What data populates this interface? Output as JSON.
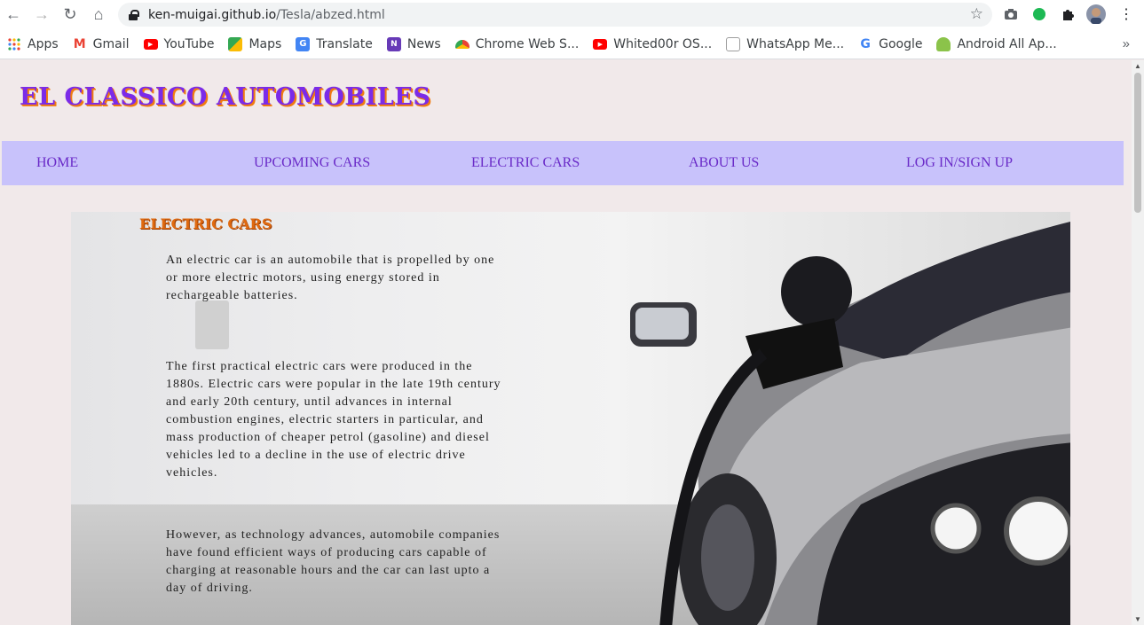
{
  "browser": {
    "url_host": "ken-muigai.github.io",
    "url_path": "/Tesla/abzed.html",
    "bookmarks": [
      {
        "label": "Apps",
        "color": "#1a73e8",
        "glyph": "⋮⋮"
      },
      {
        "label": "Gmail",
        "color": "#ea4335",
        "glyph": "M"
      },
      {
        "label": "YouTube",
        "color": "#ff0000",
        "glyph": "▶"
      },
      {
        "label": "Maps",
        "color": "#34a853",
        "glyph": "◆"
      },
      {
        "label": "Translate",
        "color": "#4285f4",
        "glyph": "G"
      },
      {
        "label": "News",
        "color": "#673ab7",
        "glyph": "N"
      },
      {
        "label": "Chrome Web S...",
        "color": "#fbbc05",
        "glyph": "◐"
      },
      {
        "label": "Whited00r OS...",
        "color": "#ff0000",
        "glyph": "▶"
      },
      {
        "label": "WhatsApp Me...",
        "color": "#9e9e9e",
        "glyph": "□"
      },
      {
        "label": "Google",
        "color": "#4285f4",
        "glyph": "G"
      },
      {
        "label": "Android All Ap...",
        "color": "#8bc34a",
        "glyph": "☺"
      }
    ],
    "more": "»"
  },
  "site": {
    "logo": "EL CLASSICO AUTOMOBILES",
    "nav": [
      "HOME",
      "UPCOMING CARS",
      "ELECTRIC CARS",
      "ABOUT US",
      "LOG IN/SIGN UP"
    ]
  },
  "content": {
    "title": "ELECTRIC CARS",
    "paragraphs": [
      "An electric car is an automobile that is propelled by one or more electric motors, using energy stored in rechargeable batteries.",
      "The first practical electric cars were produced in the 1880s. Electric cars were popular in the late 19th century and early 20th century, until advances in internal combustion engines, electric starters in particular, and mass production of cheaper petrol (gasoline) and diesel vehicles led to a decline in the use of electric drive vehicles.",
      "However, as technology advances, automobile companies have found efficient ways of producing cars capable of charging at reasonable hours and the car can last upto a day of driving."
    ]
  }
}
